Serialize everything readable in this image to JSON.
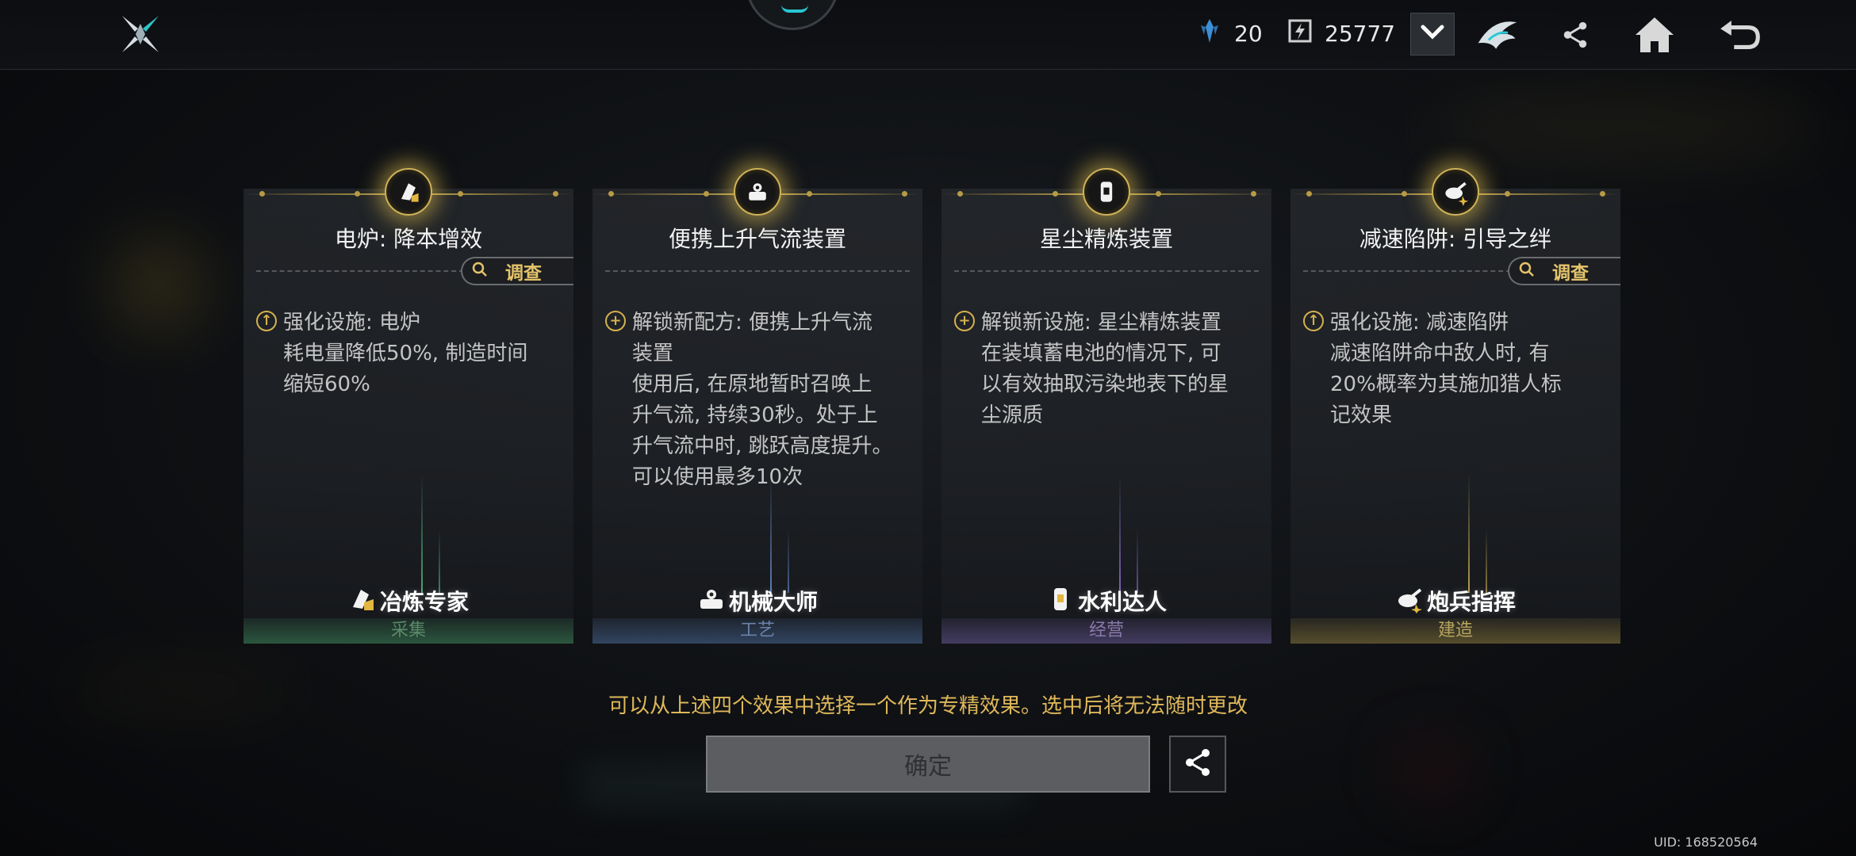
{
  "topbar": {
    "logo_icon": "crossed-blades-logo-icon",
    "currency_1": {
      "icon": "crystal-icon",
      "value": "20"
    },
    "currency_2": {
      "icon": "energy-icon",
      "value": "25777"
    },
    "dropdown_icon": "chevron-down-icon",
    "emblem_icon": "wing-emblem-icon",
    "share_icon": "share-icon",
    "home_icon": "home-icon",
    "back_icon": "back-arrow-icon"
  },
  "cards": [
    {
      "title": "电炉: 降本增效",
      "has_investigate": true,
      "investigate_label": "调查",
      "bullet_type": "upgrade",
      "description": "强化设施: 电炉\n耗电量降低50%, 制造时间\n缩短60%",
      "role": "冶炼专家",
      "role_icon": "smelter-icon",
      "category": "采集",
      "accent": "#3e8a5c"
    },
    {
      "title": "便携上升气流装置",
      "has_investigate": false,
      "bullet_type": "unlock",
      "description": "解锁新配方: 便携上升气流\n装置\n使用后, 在原地暂时召唤上\n升气流, 持续30秒。处于上\n升气流中时, 跳跃高度提升。\n可以使用最多10次",
      "role": "机械大师",
      "role_icon": "mechanic-icon",
      "category": "工艺",
      "accent": "#4a6a9a"
    },
    {
      "title": "星尘精炼装置",
      "has_investigate": false,
      "bullet_type": "unlock",
      "description": "解锁新设施: 星尘精炼装置\n在装填蓄电池的情况下, 可\n以有效抽取污染地表下的星\n尘源质",
      "role": "水利达人",
      "role_icon": "hydraulic-icon",
      "category": "经营",
      "accent": "#6a5a9a"
    },
    {
      "title": "减速陷阱: 引导之绊",
      "has_investigate": true,
      "investigate_label": "调查",
      "bullet_type": "upgrade",
      "description": "强化设施: 减速陷阱\n减速陷阱命中敌人时, 有\n20%概率为其施加猎人标\n记效果",
      "role": "炮兵指挥",
      "role_icon": "artillery-icon",
      "category": "建造",
      "accent": "#8a7a3a"
    }
  ],
  "hint": "可以从上述四个效果中选择一个作为专精效果。选中后将无法随时更改",
  "confirm_label": "确定",
  "uid": "UID: 168520564"
}
